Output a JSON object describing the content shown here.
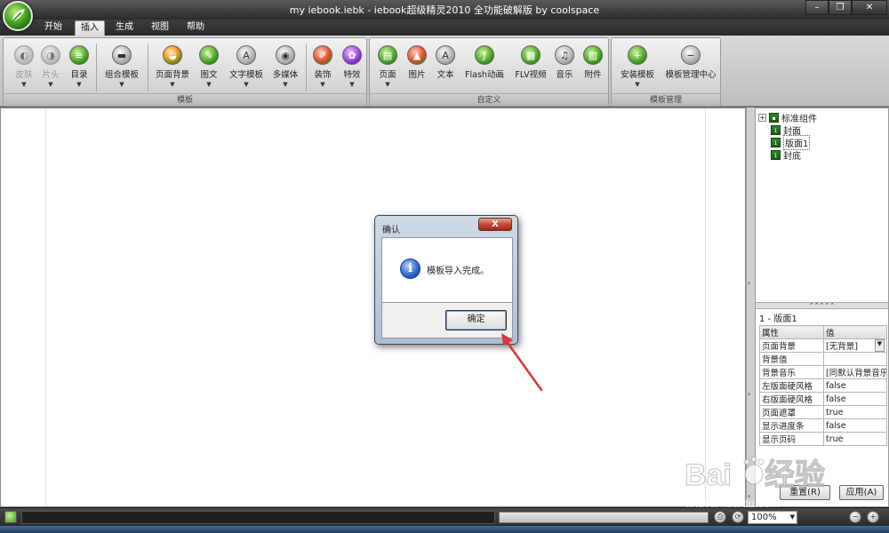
{
  "window": {
    "title": "my iebook.iebk - iebook超级精灵2010 全功能破解版 by coolspace"
  },
  "menu": {
    "tabs": [
      "开始",
      "插入",
      "生成",
      "视图",
      "帮助"
    ],
    "active_index": 1
  },
  "ribbon": {
    "groups": [
      {
        "label": "模板",
        "buttons": [
          "皮肤",
          "片头",
          "目录",
          "组合模板",
          "页面背景",
          "图文",
          "文字模板",
          "多媒体",
          "装饰",
          "特效"
        ]
      },
      {
        "label": "自定义",
        "buttons": [
          "页面",
          "图片",
          "文本",
          "Flash动画",
          "FLV视频",
          "音乐",
          "附件"
        ]
      },
      {
        "label": "模板管理",
        "buttons": [
          "安装模板",
          "模板管理中心"
        ]
      }
    ]
  },
  "tree": {
    "items": [
      "标准组件",
      "封面",
      "版面1",
      "封底"
    ]
  },
  "properties": {
    "header": "1 - 版面1",
    "columns": [
      "属性",
      "值"
    ],
    "rows": [
      {
        "key": "页面背景",
        "value": "[无背景]"
      },
      {
        "key": "背景值",
        "value": ""
      },
      {
        "key": "背景音乐",
        "value": "[同默认背景音乐]"
      },
      {
        "key": "左版面硬风格",
        "value": "false"
      },
      {
        "key": "右版面硬风格",
        "value": "false"
      },
      {
        "key": "页面遮罩",
        "value": "true"
      },
      {
        "key": "显示进度条",
        "value": "false"
      },
      {
        "key": "显示页码",
        "value": "true"
      }
    ],
    "reset_label": "重置(R)",
    "apply_label": "应用(A)"
  },
  "dialog": {
    "title": "确认",
    "close_label": "X",
    "message": "模板导入完成。",
    "ok_label": "确定"
  },
  "status": {
    "zoom": "100%"
  },
  "watermark": {
    "text": "Baidu经验",
    "sub": "jingyan.baidu.com"
  },
  "colors": {
    "arrow": "#e0323a",
    "accent_green": "#3e9a1a"
  }
}
